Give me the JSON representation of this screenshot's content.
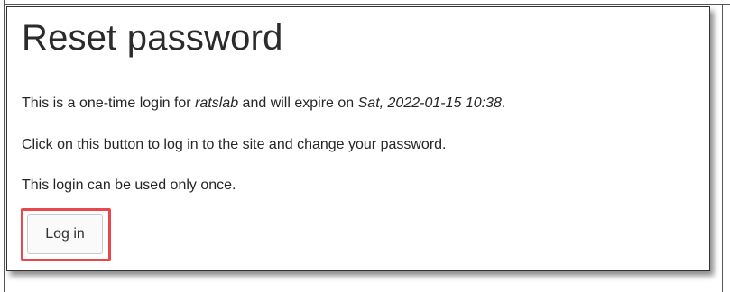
{
  "page": {
    "title": "Reset password"
  },
  "message": {
    "line1_prefix": "This is a one-time login for ",
    "username": "ratslab",
    "line1_middle": " and will expire on ",
    "expiry": "Sat, 2022-01-15 10:38",
    "line1_suffix": ".",
    "line2": "Click on this button to log in to the site and change your password.",
    "line3": "This login can be used only once."
  },
  "actions": {
    "login_label": "Log in"
  },
  "colors": {
    "highlight": "#e8474b"
  }
}
